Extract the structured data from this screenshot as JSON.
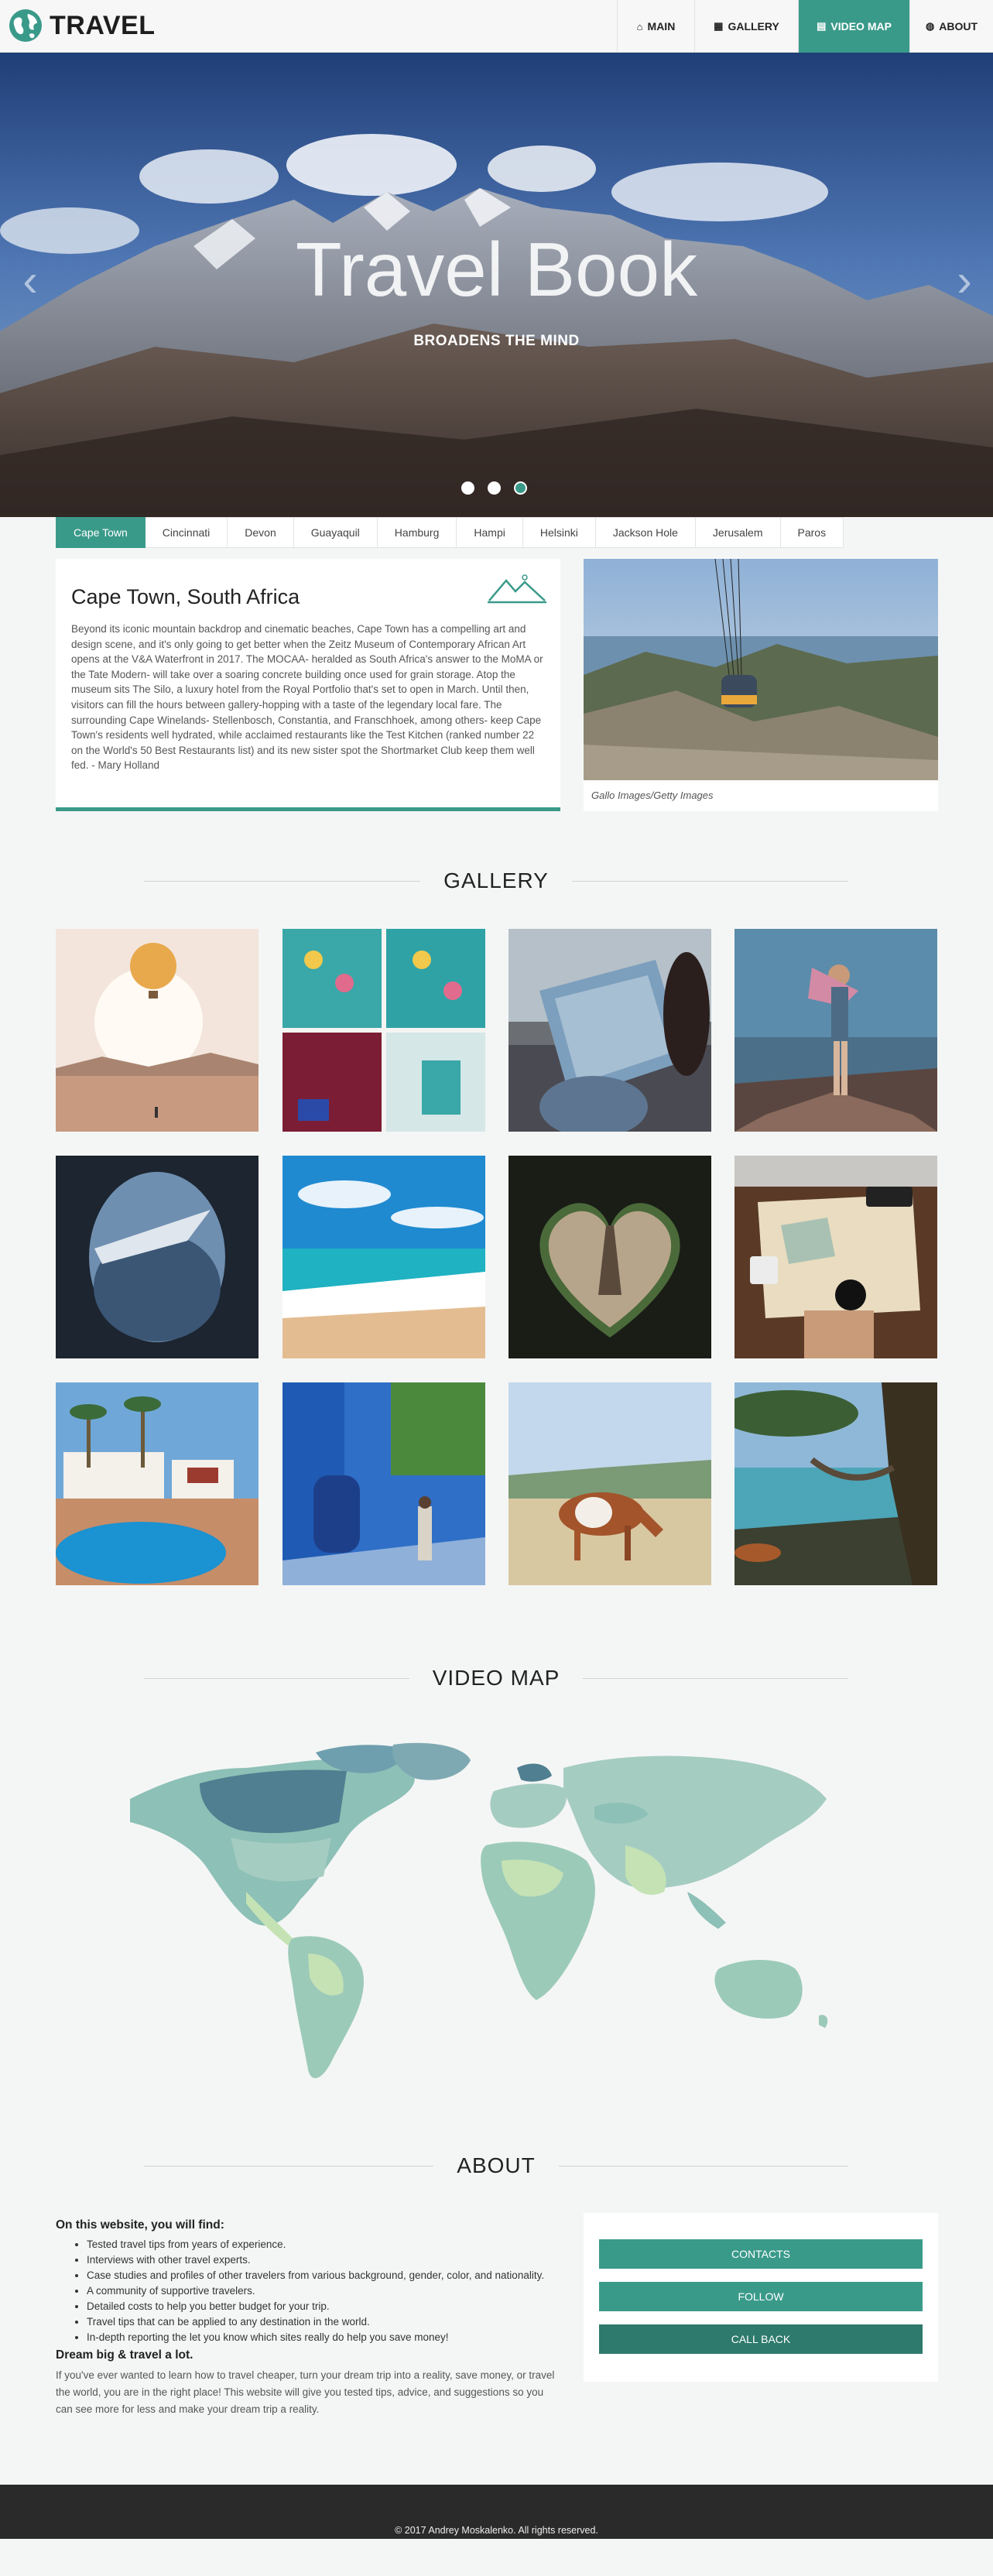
{
  "brand": {
    "name": "TRAVEL"
  },
  "nav": {
    "items": [
      {
        "label": "MAIN",
        "icon": "home-icon"
      },
      {
        "label": "GALLERY",
        "icon": "grid-icon"
      },
      {
        "label": "VIDEO MAP",
        "icon": "map-icon",
        "active": true
      },
      {
        "label": "ABOUT",
        "icon": "globe-icon"
      }
    ]
  },
  "hero": {
    "title": "Travel Book",
    "subtitle": "BROADENS THE MIND",
    "slide_count": 3,
    "active_slide": 3
  },
  "cities": {
    "tabs": [
      "Cape Town",
      "Cincinnati",
      "Devon",
      "Guayaquil",
      "Hamburg",
      "Hampi",
      "Helsinki",
      "Jackson Hole",
      "Jerusalem",
      "Paros"
    ],
    "active": "Cape Town",
    "title": "Cape Town, South Africa",
    "text": "Beyond its iconic mountain backdrop and cinematic beaches, Cape Town has a compelling art and design scene, and it's only going to get better when the Zeitz Museum of Contemporary African Art opens at the V&A Waterfront in 2017. The MOCAA- heralded as South Africa's answer to the MoMA or the Tate Modern- will take over a soaring concrete building once used for grain storage. Atop the museum sits The Silo, a luxury hotel from the Royal Portfolio that's set to open in March. Until then, visitors can fill the hours between gallery-hopping with a taste of the legendary local fare. The surrounding Cape Winelands- Stellenbosch, Constantia, and Franschhoek, among others- keep Cape Town's residents well hydrated, while acclaimed restaurants like the Test Kitchen (ranked number 22 on the World's 50 Best Restaurants list) and its new sister spot the Shortmarket Club keep them well fed. - Mary Holland",
    "photo_caption": "Gallo Images/Getty Images"
  },
  "gallery": {
    "title": "GALLERY"
  },
  "video_map": {
    "title": "VIDEO MAP"
  },
  "about": {
    "title": "ABOUT",
    "find_heading": "On this website, you will find:",
    "items": [
      "Tested travel tips from years of experience.",
      "Interviews with other travel experts.",
      "Case studies and profiles of other travelers from various background, gender, color, and nationality.",
      "A community of supportive travelers.",
      "Detailed costs to help you better budget for your trip.",
      "Travel tips that can be applied to any destination in the world.",
      "In-depth reporting the let you know which sites really do help you save money!"
    ],
    "dream_heading": "Dream big & travel a lot.",
    "paragraph": "If you've ever wanted to learn how to travel cheaper, turn your dream trip into a reality, save money, or travel the world, you are in the right place! This website will give you tested tips, advice, and suggestions so you can see more for less and make your dream trip a reality.",
    "buttons": [
      "CONTACTS",
      "FOLLOW",
      "CALL BACK"
    ]
  },
  "footer": {
    "copyright": "© 2017 Andrey Moskalenko. All rights reserved."
  },
  "colors": {
    "accent": "#3a9a8a",
    "accent_dark": "#2e7a6d",
    "footer": "#2a2a2a"
  }
}
